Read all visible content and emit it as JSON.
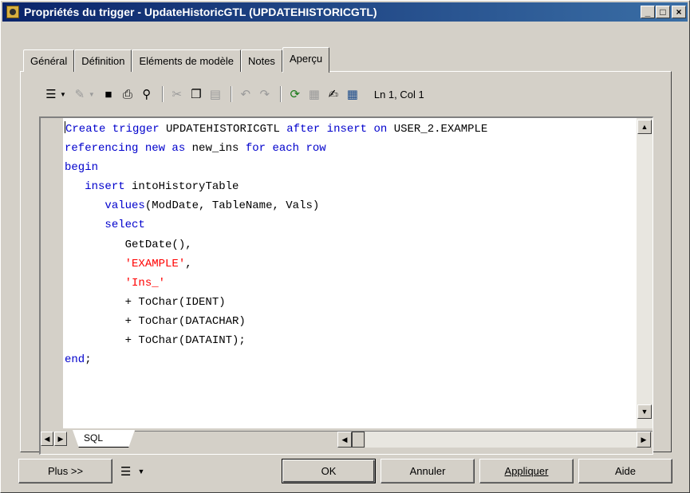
{
  "window": {
    "title": "Propriétés du trigger - UpdateHistoricGTL (UPDATEHISTORICGTL)",
    "title_icon": "trigger-properties-icon"
  },
  "tabs": [
    "Général",
    "Définition",
    "Eléments de modèle",
    "Notes",
    "Aperçu"
  ],
  "active_tab": "Aperçu",
  "toolbar": {
    "icons": [
      "editor-menu-icon",
      "properties-icon",
      "save-icon",
      "print-icon",
      "find-icon",
      "cut-icon",
      "copy-icon",
      "paste-icon",
      "undo-icon",
      "redo-icon",
      "refresh-icon",
      "options-icon",
      "edit-icon",
      "preview-icon"
    ],
    "cursor_position": "Ln 1, Col 1"
  },
  "code_lines": [
    [
      {
        "t": "Create trigger ",
        "c": "kw"
      },
      {
        "t": "UPDATEHISTORICGTL ",
        "c": ""
      },
      {
        "t": "after insert on ",
        "c": "kw"
      },
      {
        "t": "USER_2.EXAMPLE",
        "c": ""
      }
    ],
    [
      {
        "t": "referencing new as ",
        "c": "kw"
      },
      {
        "t": "new_ins ",
        "c": ""
      },
      {
        "t": "for each row",
        "c": "kw"
      }
    ],
    [
      {
        "t": "begin",
        "c": "kw"
      }
    ],
    [
      {
        "t": "   ",
        "c": ""
      },
      {
        "t": "insert ",
        "c": "kw"
      },
      {
        "t": "intoHistoryTable",
        "c": ""
      }
    ],
    [
      {
        "t": "      ",
        "c": ""
      },
      {
        "t": "values",
        "c": "kw"
      },
      {
        "t": "(ModDate, TableName, Vals)",
        "c": ""
      }
    ],
    [
      {
        "t": "      ",
        "c": ""
      },
      {
        "t": "select",
        "c": "kw"
      }
    ],
    [
      {
        "t": "         GetDate(),",
        "c": ""
      }
    ],
    [
      {
        "t": "         ",
        "c": ""
      },
      {
        "t": "'EXAMPLE'",
        "c": "str"
      },
      {
        "t": ",",
        "c": ""
      }
    ],
    [
      {
        "t": "         ",
        "c": ""
      },
      {
        "t": "'Ins_'",
        "c": "str"
      }
    ],
    [
      {
        "t": "         + ToChar(IDENT)",
        "c": ""
      }
    ],
    [
      {
        "t": "         + ToChar(DATACHAR)",
        "c": ""
      }
    ],
    [
      {
        "t": "         + ToChar(DATAINT);",
        "c": ""
      }
    ],
    [
      {
        "t": "end",
        "c": "kw"
      },
      {
        "t": ";",
        "c": ""
      }
    ]
  ],
  "sheet_tab": "SQL",
  "buttons": {
    "plus": "Plus >>",
    "ok": "OK",
    "annuler": "Annuler",
    "appliquer": "Appliquer",
    "aide": "Aide"
  },
  "colors": {
    "keyword": "#0000cc",
    "string": "#ff0000",
    "titlebar": "#0a246a"
  }
}
